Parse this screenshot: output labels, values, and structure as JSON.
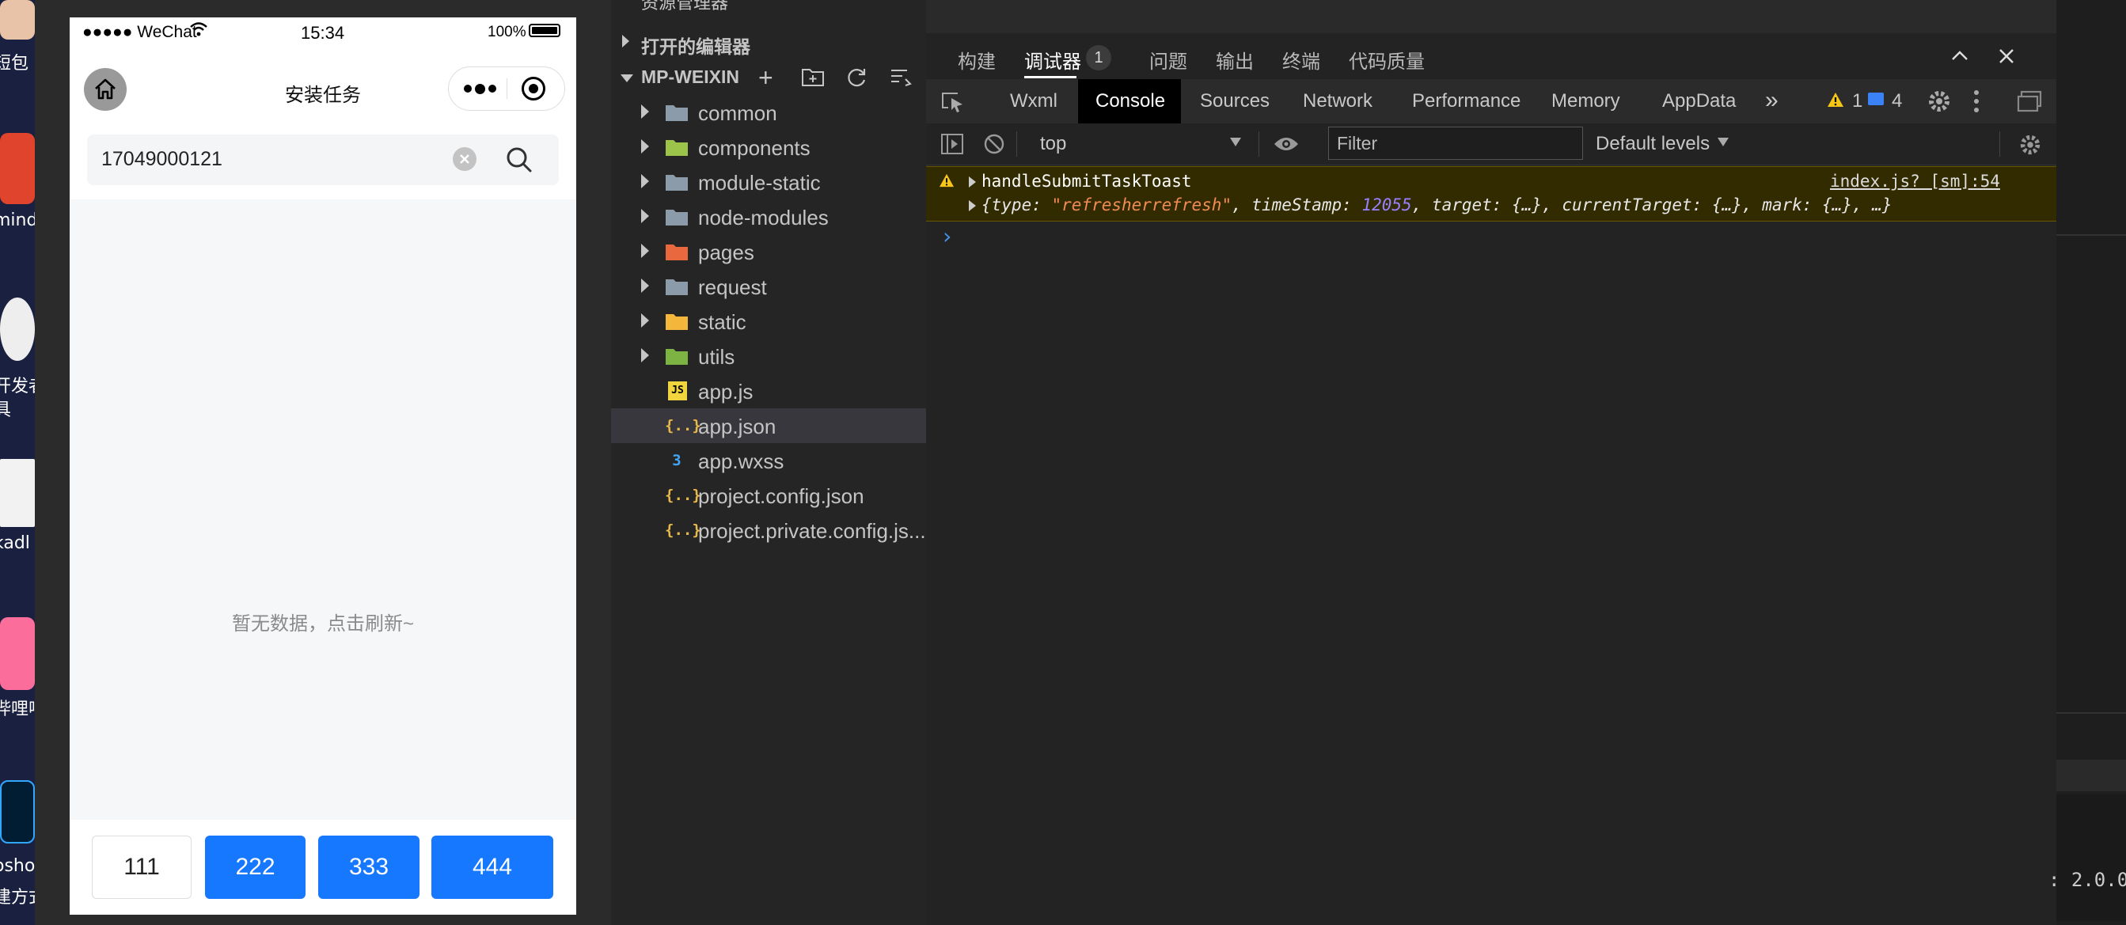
{
  "desktop": {
    "labels": [
      "短包",
      "mind",
      "开发者",
      "具",
      "kadl",
      "哔哩哔",
      "osho",
      "建方式"
    ]
  },
  "phone": {
    "status": {
      "carrier": "●●●●● WeChat",
      "time": "15:34",
      "battery": "100%"
    },
    "title": "安装任务",
    "search_value": "17049000121",
    "empty_text": "暂无数据，点击刷新~",
    "buttons": [
      "111",
      "222",
      "333",
      "444"
    ],
    "colors": {
      "primary": "#1677ff"
    }
  },
  "explorer": {
    "header": "资源管理器",
    "open_editors": "打开的编辑器",
    "project": "MP-WEIXIN",
    "items": [
      {
        "label": "common",
        "type": "folder"
      },
      {
        "label": "components",
        "type": "folder"
      },
      {
        "label": "module-static",
        "type": "folder"
      },
      {
        "label": "node-modules",
        "type": "folder"
      },
      {
        "label": "pages",
        "type": "folder"
      },
      {
        "label": "request",
        "type": "folder"
      },
      {
        "label": "static",
        "type": "folder"
      },
      {
        "label": "utils",
        "type": "folder"
      },
      {
        "label": "app.js",
        "type": "file"
      },
      {
        "label": "app.json",
        "type": "file"
      },
      {
        "label": "app.wxss",
        "type": "file"
      },
      {
        "label": "project.config.json",
        "type": "file"
      },
      {
        "label": "project.private.config.js...",
        "type": "file"
      }
    ]
  },
  "devtools": {
    "top_tabs": [
      "构建",
      "调试器",
      "问题",
      "输出",
      "终端",
      "代码质量"
    ],
    "debugger_badge": "1",
    "panel_tabs": [
      "Wxml",
      "Console",
      "Sources",
      "Network",
      "Performance",
      "Memory",
      "AppData"
    ],
    "warn_count": "1",
    "info_count": "4",
    "context": "top",
    "filter_placeholder": "Filter",
    "levels": "Default levels",
    "log": {
      "message": "handleSubmitTaskToast",
      "source": "index.js? [sm]:54",
      "obj_open": "{type: ",
      "obj_type": "\"refresherrefresh\"",
      "obj_mid": ", timeStamp: ",
      "obj_ts": "12055",
      "obj_rest": ", target: {…}, currentTarget: {…}, mark: {…}, …}"
    },
    "prompt": "›"
  },
  "right": {
    "version_text": ": 2.0.0"
  }
}
